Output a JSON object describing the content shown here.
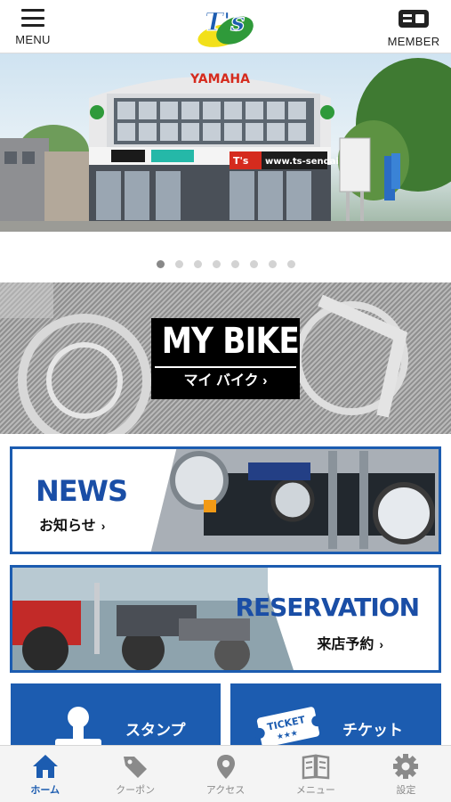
{
  "header": {
    "menu_label": "MENU",
    "member_label": "MEMBER",
    "logo_text": "T's"
  },
  "hero": {
    "store_sign": "YAMAHA",
    "store_url_sign": "www.ts-sendai.co",
    "badge_text": "T's",
    "slide_count": 8,
    "active_slide": 1
  },
  "mybike": {
    "title": "MY BIKE",
    "subtitle": "マイ バイク ›"
  },
  "news": {
    "title": "NEWS",
    "subtitle": "お知らせ",
    "arrow": "›"
  },
  "reservation": {
    "title": "RESERVATION",
    "subtitle": "来店予約",
    "arrow": "›"
  },
  "tiles": {
    "stamp_label": "スタンプ",
    "ticket_label": "チケット",
    "ticket_icon_text": "TICKET"
  },
  "tabbar": {
    "items": [
      {
        "label": "ホーム",
        "icon": "home-icon",
        "active": true
      },
      {
        "label": "クーポン",
        "icon": "coupon-tag-icon",
        "active": false
      },
      {
        "label": "アクセス",
        "icon": "map-pin-icon",
        "active": false
      },
      {
        "label": "メニュー",
        "icon": "book-icon",
        "active": false
      },
      {
        "label": "設定",
        "icon": "gear-icon",
        "active": false
      }
    ]
  },
  "colors": {
    "brand_blue": "#1c5cb0",
    "logo_green": "#2f9a3a",
    "logo_yellow": "#f2e01a",
    "hero_red": "#d52b1e"
  }
}
